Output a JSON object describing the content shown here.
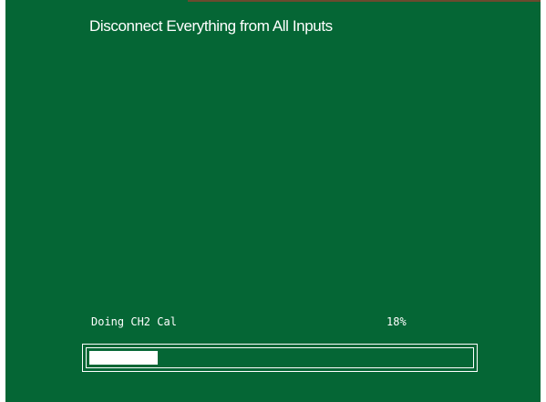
{
  "message": "Disconnect Everything from All Inputs",
  "status": {
    "label": "Doing CH2 Cal",
    "percent_text": "18%",
    "progress": 0.18
  },
  "colors": {
    "background": "#056635",
    "foreground": "#ffffff"
  }
}
